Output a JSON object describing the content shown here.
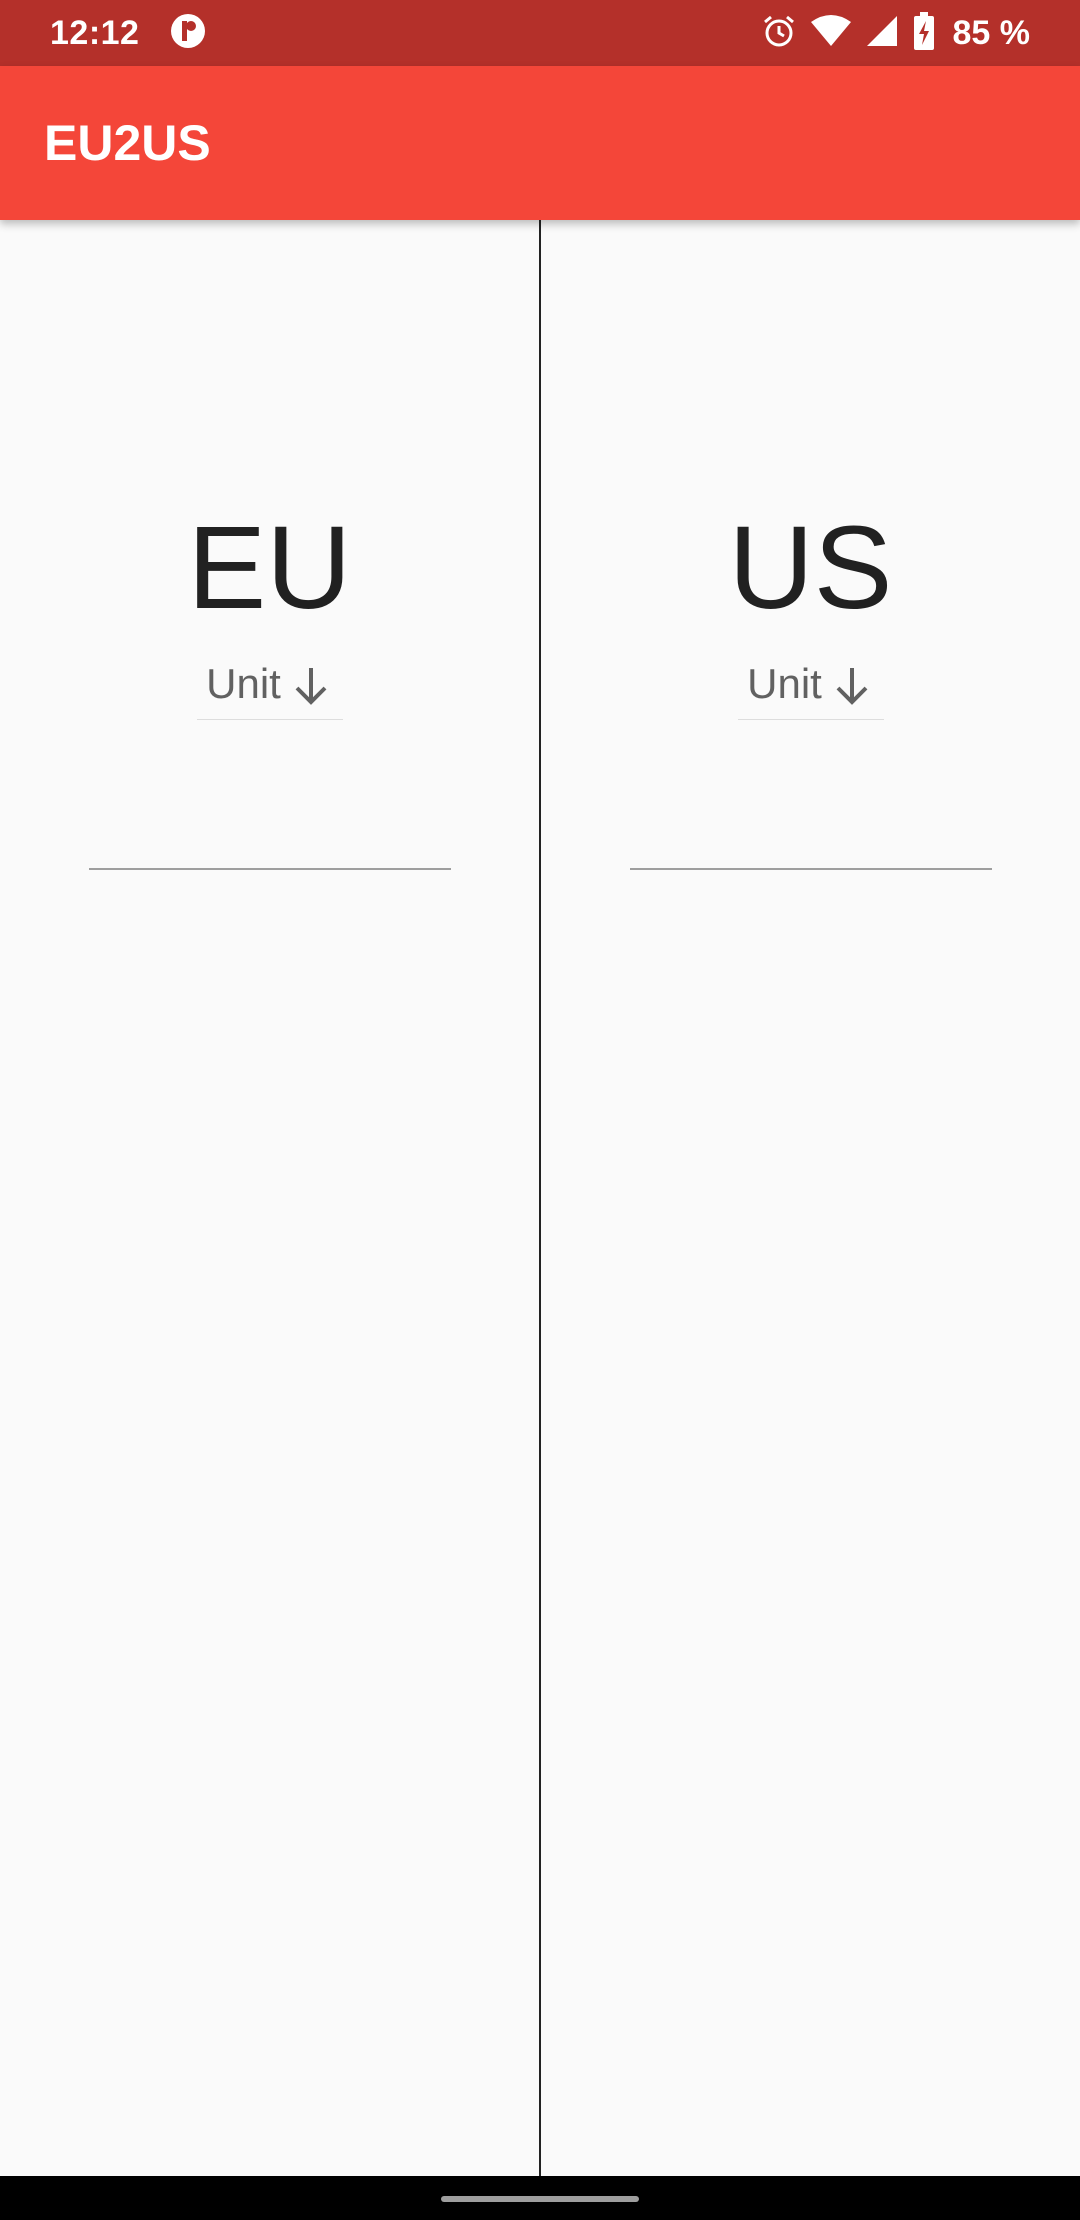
{
  "status_bar": {
    "time": "12:12",
    "battery_percent": "85 %",
    "icons": [
      "app-notification-icon",
      "alarm-icon",
      "wifi-icon",
      "signal-icon",
      "battery-charging-icon"
    ]
  },
  "app_bar": {
    "title": "EU2US"
  },
  "panels": [
    {
      "title": "EU",
      "unit_label": "Unit",
      "value": ""
    },
    {
      "title": "US",
      "unit_label": "Unit",
      "value": ""
    }
  ],
  "colors": {
    "status_bar": "#b4302a",
    "app_bar": "#f44639",
    "background": "#fafafa",
    "text_primary": "#212121",
    "text_secondary": "#616161"
  }
}
